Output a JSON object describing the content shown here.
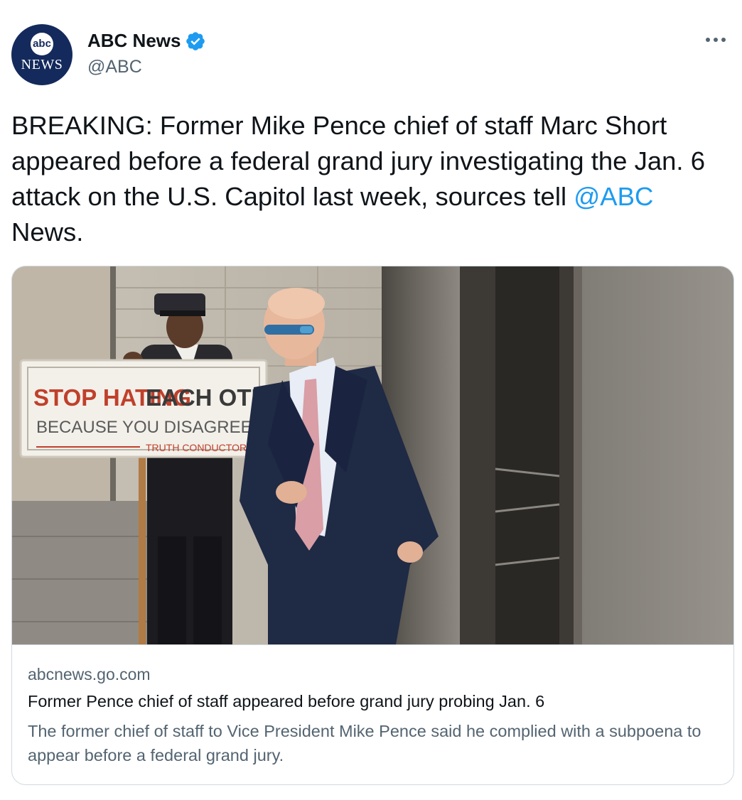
{
  "author": {
    "display_name": "ABC News",
    "handle": "@ABC",
    "verified": true,
    "avatar_logo_text": "abc",
    "avatar_logo_subtext": "NEWS"
  },
  "tweet": {
    "text_before_mention": "BREAKING: Former Mike Pence chief of staff Marc Short appeared before a federal grand jury investigating the Jan. 6 attack on the U.S. Capitol last week, sources tell ",
    "mention": "@ABC",
    "text_after_mention": " News."
  },
  "card": {
    "image_sign": {
      "line1_red": "STOP HATING",
      "line1_dark": "EACH OTHER",
      "line2": "BECAUSE YOU DISAGREE...",
      "line3": "TRUTH CONDUCTOR"
    },
    "domain": "abcnews.go.com",
    "title": "Former Pence chief of staff appeared before grand jury probing Jan. 6",
    "description": "The former chief of staff to Vice President Mike Pence said he complied with a subpoena to appear before a federal grand jury."
  },
  "colors": {
    "link": "#1d9bf0",
    "verified_badge": "#1d9bf0",
    "secondary_text": "#536471",
    "abc_navy": "#142a5c"
  },
  "icons": {
    "verified": "verified-badge-icon",
    "more": "more-options-icon"
  }
}
